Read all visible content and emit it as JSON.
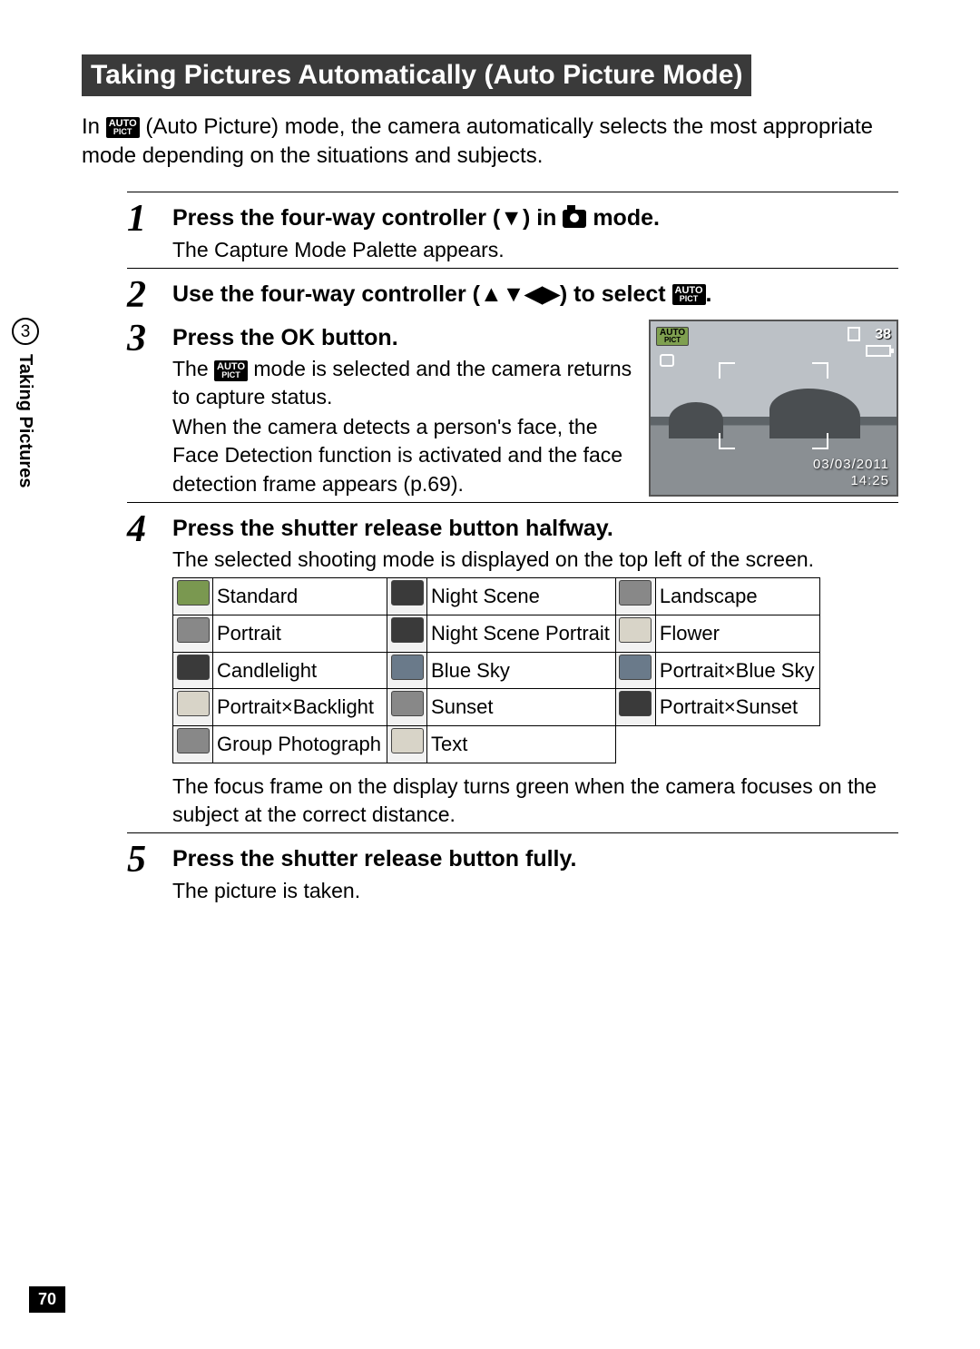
{
  "title": "Taking Pictures Automatically (Auto Picture Mode)",
  "intro_pre": "In ",
  "intro_post": " (Auto Picture) mode, the camera automatically selects the most appropriate mode depending on the situations and subjects.",
  "autopict_label_top": "AUTO",
  "autopict_label_bottom": "PICT",
  "sidebar": {
    "chapter_num": "3",
    "chapter_label": "Taking Pictures"
  },
  "page_number": "70",
  "steps": {
    "s1": {
      "num": "1",
      "head_pre": "Press the four-way controller (▼) in ",
      "head_post": " mode.",
      "desc": "The Capture Mode Palette appears."
    },
    "s2": {
      "num": "2",
      "head_pre": "Use the four-way controller (▲▼◀▶) to select ",
      "head_post": "."
    },
    "s3": {
      "num": "3",
      "head_pre": "Press the ",
      "ok": "OK",
      "head_post": " button.",
      "desc_pre": "The ",
      "desc_post": " mode is selected and the camera returns to capture status.",
      "desc2": "When the camera detects a person's face, the Face Detection function is activated and the face detection frame appears (p.69)."
    },
    "s4": {
      "num": "4",
      "head": "Press the shutter release button halfway.",
      "desc": "The selected shooting mode is displayed on the top left of the screen.",
      "after_table": "The focus frame on the display turns green when the camera focuses on the subject at the correct distance."
    },
    "s5": {
      "num": "5",
      "head": "Press the shutter release button fully.",
      "desc": "The picture is taken."
    }
  },
  "lcd": {
    "count": "38",
    "date": "03/03/2011",
    "time": "14:25"
  },
  "modes": {
    "r1c1": "Standard",
    "r1c2": "Night Scene",
    "r1c3": "Landscape",
    "r2c1": "Portrait",
    "r2c2": "Night Scene Portrait",
    "r2c3": "Flower",
    "r3c1": "Candlelight",
    "r3c2": "Blue Sky",
    "r3c3": "Portrait×Blue Sky",
    "r4c1": "Portrait×Backlight",
    "r4c2": "Sunset",
    "r4c3": "Portrait×Sunset",
    "r5c1": "Group Photograph",
    "r5c2": "Text"
  }
}
